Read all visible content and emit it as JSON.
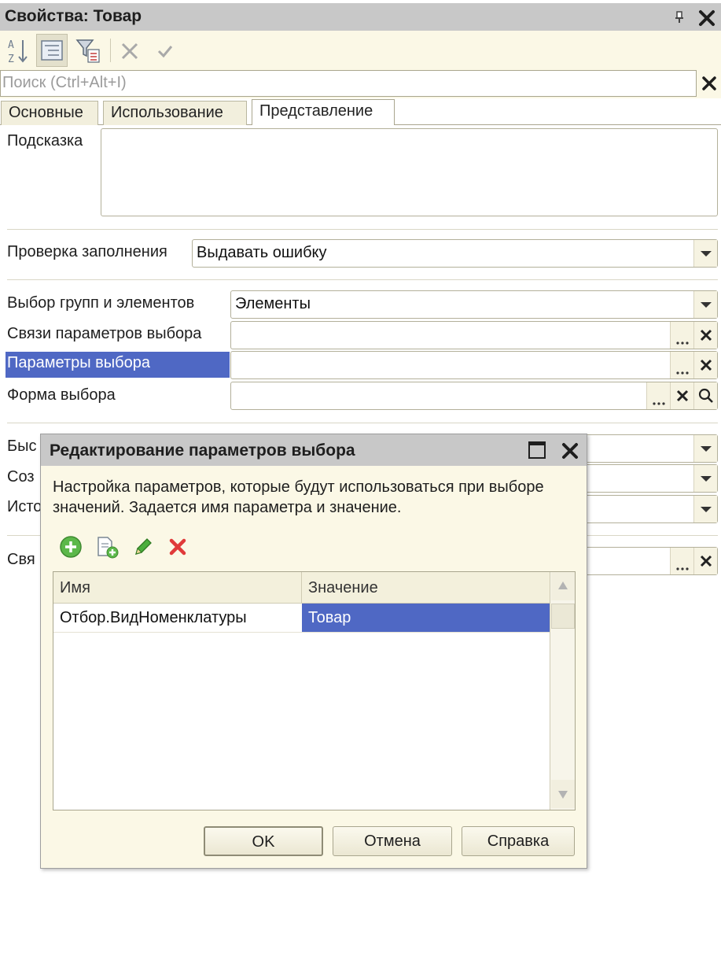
{
  "window": {
    "title": "Свойства: Товар",
    "search_placeholder": "Поиск (Ctrl+Alt+I)"
  },
  "toolbar": {
    "icons": [
      "sort-az-icon",
      "categories-icon",
      "filter-icon",
      "cancel-icon",
      "apply-icon"
    ]
  },
  "tabs": [
    {
      "label": "Основные",
      "active": false
    },
    {
      "label": "Использование",
      "active": false
    },
    {
      "label": "Представление",
      "active": true
    }
  ],
  "form": {
    "hint_label": "Подсказка",
    "hint_value": "",
    "fill_check_label": "Проверка заполнения",
    "fill_check_value": "Выдавать ошибку",
    "group_choice_label": "Выбор групп и элементов",
    "group_choice_value": "Элементы",
    "choice_links_label": "Связи параметров выбора",
    "choice_params_label": "Параметры выбора",
    "choice_form_label": "Форма выбора",
    "partial_label_1": "Быс",
    "partial_label_2": "Соз",
    "partial_label_3": "Исто",
    "partial_label_4": "Свя"
  },
  "dialog": {
    "title": "Редактирование параметров выбора",
    "description": "Настройка параметров, которые будут использоваться при выборе значений. Задается имя параметра и значение.",
    "tools": [
      "add-icon",
      "copy-icon",
      "edit-icon",
      "delete-icon"
    ],
    "grid": {
      "columns": [
        "Имя",
        "Значение"
      ],
      "rows": [
        {
          "name": "Отбор.ВидНоменклатуры",
          "value": "Товар"
        }
      ]
    },
    "buttons": {
      "ok": "OK",
      "cancel": "Отмена",
      "help": "Справка"
    }
  },
  "colors": {
    "selection": "#4f68c4",
    "panel_bg": "#fbf8e6",
    "title_bg": "#c8c8c8"
  }
}
